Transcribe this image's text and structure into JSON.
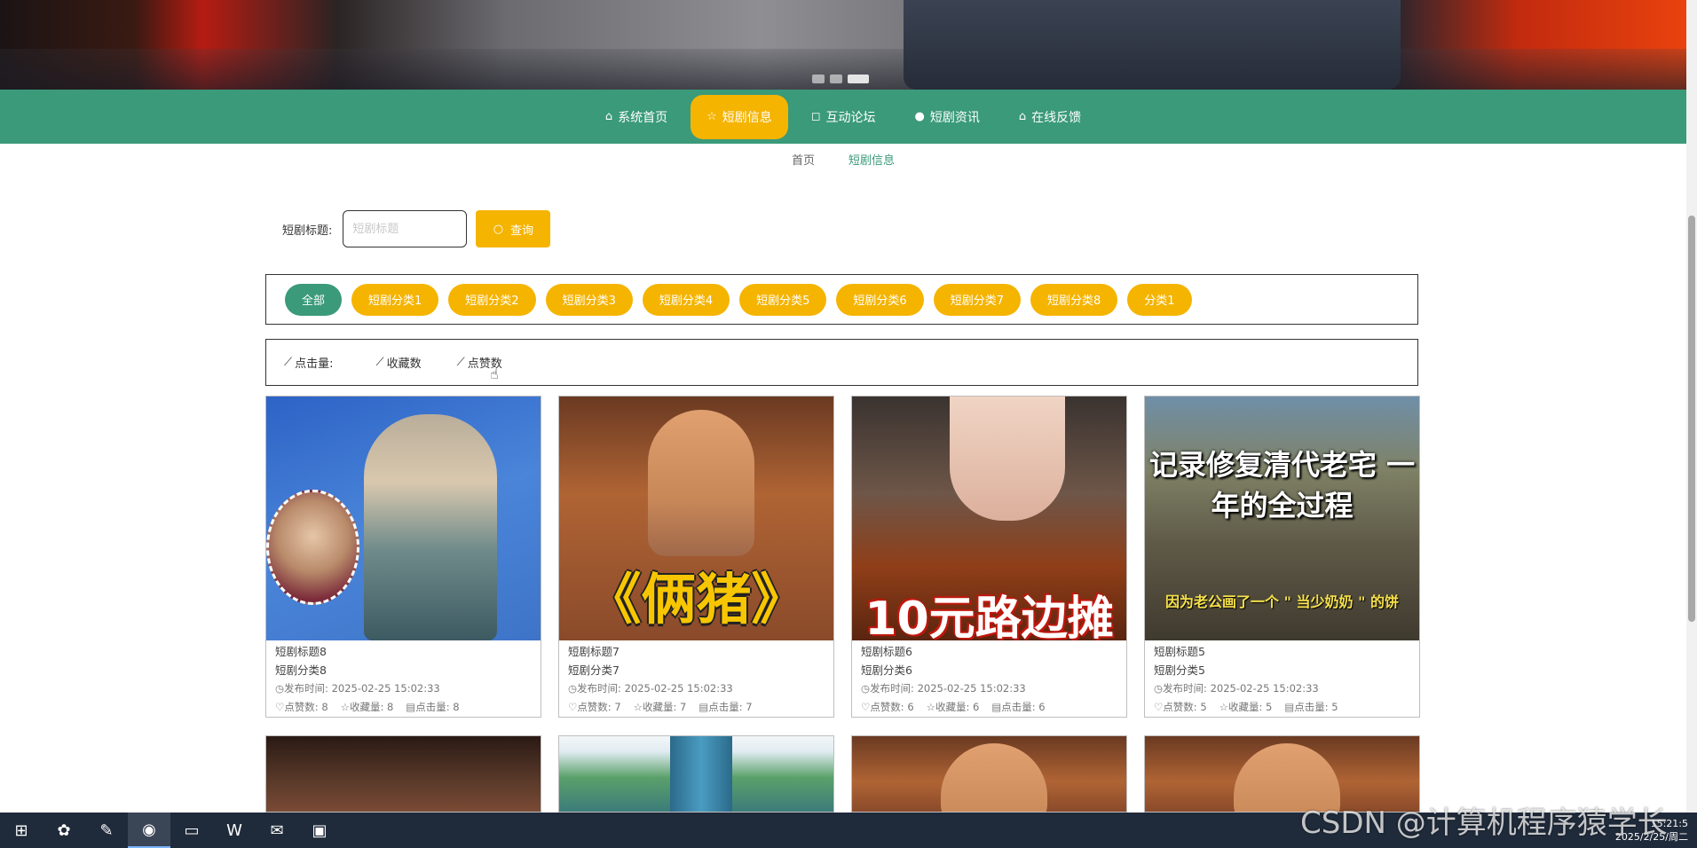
{
  "nav": {
    "items": [
      {
        "label": "系统首页",
        "icon": "home-icon"
      },
      {
        "label": "短剧信息",
        "icon": "star-icon"
      },
      {
        "label": "互动论坛",
        "icon": "bag-icon"
      },
      {
        "label": "短剧资讯",
        "icon": "info-icon"
      },
      {
        "label": "在线反馈",
        "icon": "home-icon"
      }
    ],
    "active_index": 1
  },
  "breadcrumb": {
    "home": "首页",
    "current": "短剧信息"
  },
  "search": {
    "label": "短剧标题:",
    "placeholder": "短剧标题",
    "button": "查询"
  },
  "categories": [
    "全部",
    "短剧分类1",
    "短剧分类2",
    "短剧分类3",
    "短剧分类4",
    "短剧分类5",
    "短剧分类6",
    "短剧分类7",
    "短剧分类8",
    "分类1"
  ],
  "sort": {
    "click": "点击量:",
    "fav": "收藏数",
    "like": "点赞数"
  },
  "cards": [
    {
      "title": "短剧标题8",
      "category": "短剧分类8",
      "time_label": "发布时间:",
      "time": "2025-02-25 15:02:33",
      "like_label": "点赞数:",
      "like": "8",
      "fav_label": "收藏量:",
      "fav": "8",
      "click_label": "点击量:",
      "click": "8"
    },
    {
      "title": "短剧标题7",
      "category": "短剧分类7",
      "time_label": "发布时间:",
      "time": "2025-02-25 15:02:33",
      "like_label": "点赞数:",
      "like": "7",
      "fav_label": "收藏量:",
      "fav": "7",
      "click_label": "点击量:",
      "click": "7",
      "thumb_text": "《俩猪》"
    },
    {
      "title": "短剧标题6",
      "category": "短剧分类6",
      "time_label": "发布时间:",
      "time": "2025-02-25 15:02:33",
      "like_label": "点赞数:",
      "like": "6",
      "fav_label": "收藏量:",
      "fav": "6",
      "click_label": "点击量:",
      "click": "6",
      "thumb_text": "10元路边摊"
    },
    {
      "title": "短剧标题5",
      "category": "短剧分类5",
      "time_label": "发布时间:",
      "time": "2025-02-25 15:02:33",
      "like_label": "点赞数:",
      "like": "5",
      "fav_label": "收藏量:",
      "fav": "5",
      "click_label": "点击量:",
      "click": "5",
      "thumb_text": "记录修复清代老宅 一年的全过程",
      "thumb_sub": "因为老公画了一个 \" 当少奶奶 \" 的饼"
    }
  ],
  "taskbar": {
    "time": "15:21:5",
    "date": "2025/2/25/周二"
  },
  "watermark": "CSDN @计算机程序猿学长"
}
